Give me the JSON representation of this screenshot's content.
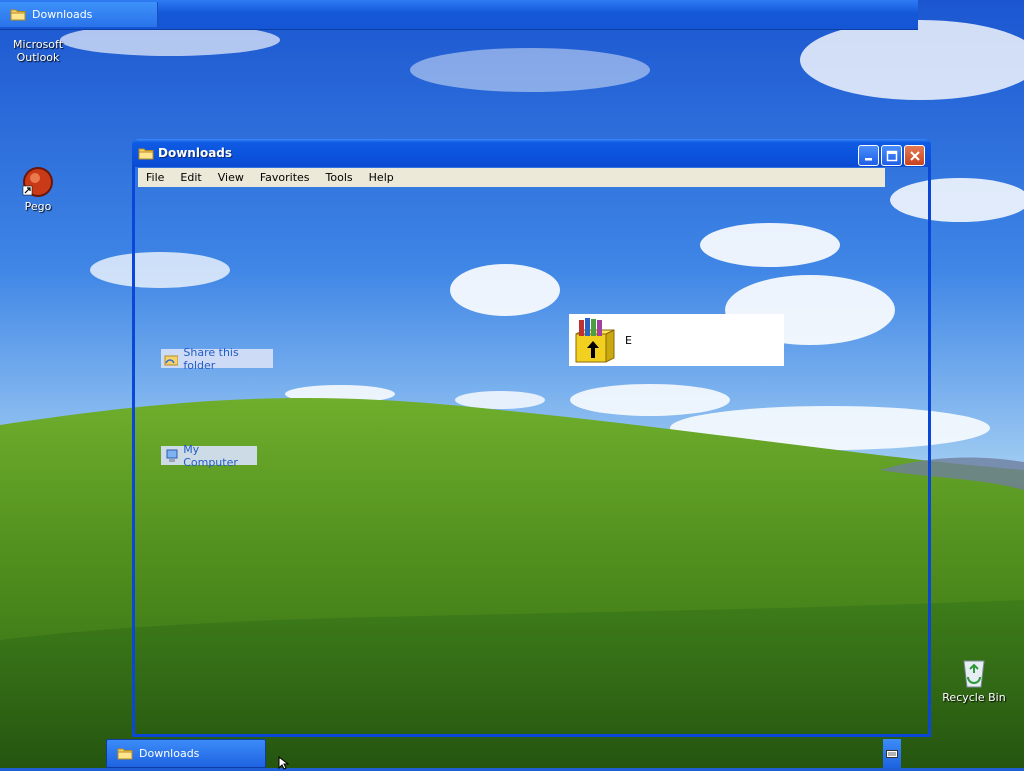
{
  "top_bar": {
    "button_label": "Downloads"
  },
  "desktop_icons": [
    {
      "name": "outlook",
      "label": "Microsoft Outlook"
    },
    {
      "name": "pego",
      "label": "Pego"
    },
    {
      "name": "recycle-bin",
      "label": "Recycle Bin"
    }
  ],
  "window": {
    "title": "Downloads",
    "menu": [
      "File",
      "Edit",
      "View",
      "Favorites",
      "Tools",
      "Help"
    ],
    "tasks": {
      "share": "Share this folder",
      "my_computer": "My Computer"
    },
    "file": {
      "name": "E",
      "icon": "winrar-archive-icon"
    }
  },
  "taskbar": {
    "button_label": "Downloads"
  },
  "colors": {
    "titlebar": "#0b52dc",
    "menu_bg": "#ece9d8",
    "task_link": "#215dc6",
    "close_button": "#c8431f"
  }
}
